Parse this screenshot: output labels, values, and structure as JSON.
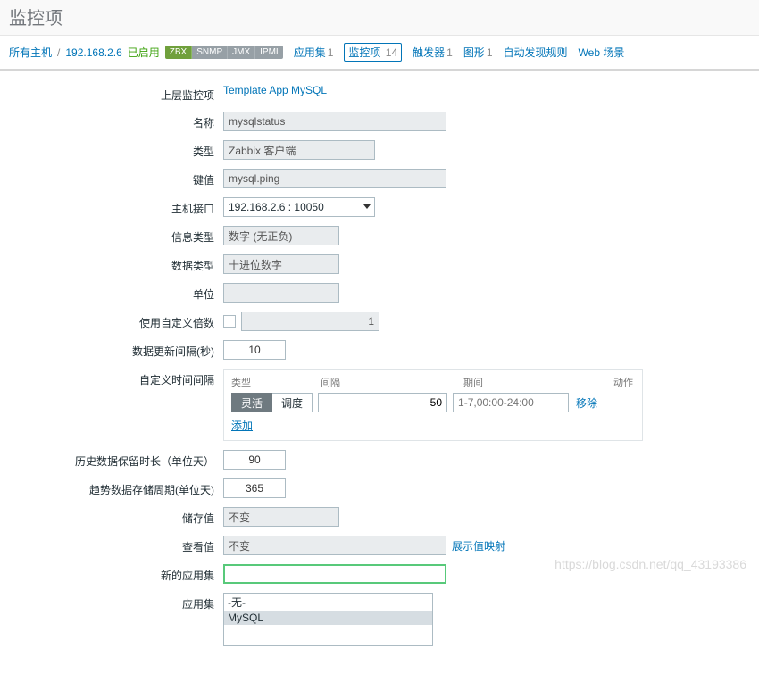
{
  "title": "监控项",
  "breadcrumb": {
    "all_hosts": "所有主机",
    "host_ip": "192.168.2.6",
    "enabled": "已启用"
  },
  "host_tags": [
    "ZBX",
    "SNMP",
    "JMX",
    "IPMI"
  ],
  "nav": {
    "apps": {
      "label": "应用集",
      "count": "1"
    },
    "items": {
      "label": "监控项",
      "count": "14"
    },
    "triggers": {
      "label": "触发器",
      "count": "1"
    },
    "graphs": {
      "label": "图形",
      "count": "1"
    },
    "discovery": {
      "label": "自动发现规则"
    },
    "web": {
      "label": "Web 场景"
    }
  },
  "form": {
    "parent_label": "上层监控项",
    "parent_link": "Template App MySQL",
    "name_label": "名称",
    "name_value": "mysqlstatus",
    "type_label": "类型",
    "type_value": "Zabbix 客户端",
    "key_label": "键值",
    "key_value": "mysql.ping",
    "iface_label": "主机接口",
    "iface_value": "192.168.2.6 : 10050",
    "info_label": "信息类型",
    "info_value": "数字 (无正负)",
    "data_label": "数据类型",
    "data_value": "十进位数字",
    "unit_label": "单位",
    "unit_value": "",
    "mult_label": "使用自定义倍数",
    "mult_value": "1",
    "interval_label": "数据更新间隔(秒)",
    "interval_value": "10",
    "custom_int_label": "自定义时间间隔",
    "custom_int": {
      "h_type": "类型",
      "h_interval": "间隔",
      "h_period": "期间",
      "h_action": "动作",
      "tab_flex": "灵活",
      "tab_sched": "调度",
      "val_interval": "50",
      "val_period": "1-7,00:00-24:00",
      "remove": "移除",
      "add": "添加"
    },
    "history_label": "历史数据保留时长（单位天）",
    "history_value": "90",
    "trend_label": "趋势数据存储周期(单位天)",
    "trend_value": "365",
    "store_label": "储存值",
    "store_value": "不变",
    "show_label": "查看值",
    "show_value": "不变",
    "show_map": "展示值映射",
    "newapp_label": "新的应用集",
    "newapp_value": "",
    "apps_label": "应用集",
    "apps_opts": {
      "none": "-无-",
      "mysql": "MySQL"
    }
  },
  "watermark": "https://blog.csdn.net/qq_43193386"
}
